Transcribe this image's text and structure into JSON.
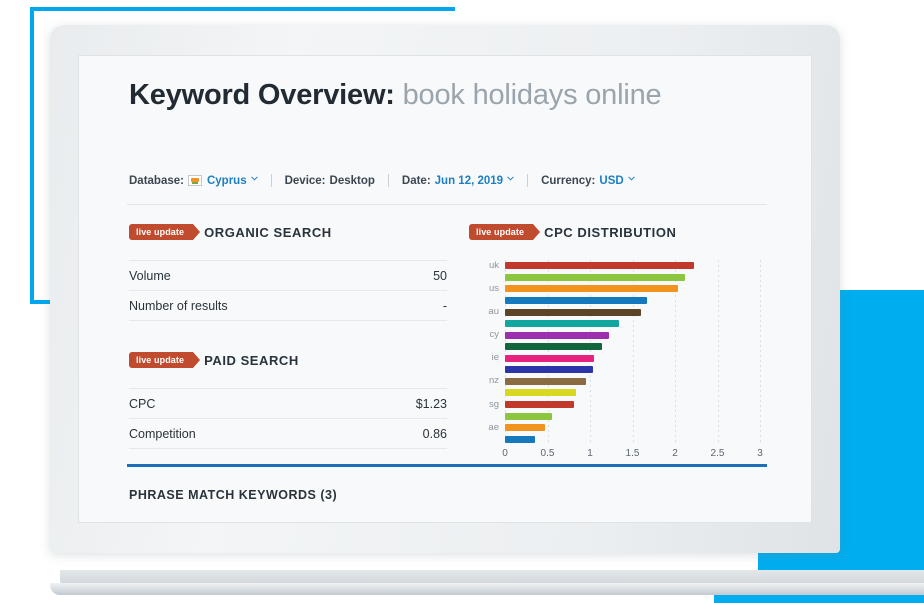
{
  "header": {
    "title_prefix": "Keyword Overview:",
    "keyword": "book holidays online"
  },
  "metabar": {
    "database_label": "Database:",
    "database_value": "Cyprus",
    "device_label": "Device:",
    "device_value": "Desktop",
    "date_label": "Date:",
    "date_value": "Jun 12, 2019",
    "currency_label": "Currency:",
    "currency_value": "USD"
  },
  "organic": {
    "badge": "live update",
    "title": "ORGANIC SEARCH",
    "rows": [
      {
        "label": "Volume",
        "value": "50"
      },
      {
        "label": "Number of results",
        "value": "-"
      }
    ]
  },
  "paid": {
    "badge": "live update",
    "title": "PAID SEARCH",
    "rows": [
      {
        "label": "CPC",
        "value": "$1.23"
      },
      {
        "label": "Competition",
        "value": "0.86"
      }
    ]
  },
  "cpc_section": {
    "badge": "live update",
    "title": "CPC DISTRIBUTION"
  },
  "bottom": {
    "phrase_match_title": "PHRASE MATCH KEYWORDS (3)"
  },
  "colors": {
    "accent_blue": "#00ADEF",
    "badge_red": "#c04b2e",
    "rule_blue": "#1c6fba",
    "link_blue": "#1c7fc4"
  },
  "chart_data": {
    "type": "bar",
    "orientation": "horizontal",
    "title": "CPC DISTRIBUTION",
    "xlabel": "",
    "ylabel": "",
    "xlim": [
      0,
      3
    ],
    "xticks": [
      0,
      0.5,
      1,
      1.5,
      2,
      2.5,
      3
    ],
    "xtick_labels": [
      "0",
      "0.5",
      "1",
      "1.5",
      "2",
      "2.5",
      "3"
    ],
    "grid": true,
    "legend": false,
    "categories": [
      "uk",
      "",
      "us",
      "",
      "au",
      "",
      "cy",
      "",
      "ie",
      "",
      "nz",
      "",
      "sg",
      "",
      "ae"
    ],
    "visible_ytick_labels": [
      "uk",
      "us",
      "au",
      "cy",
      "ie",
      "nz",
      "sg",
      "ae"
    ],
    "values": [
      2.22,
      2.12,
      2.04,
      1.67,
      1.6,
      1.34,
      1.22,
      1.14,
      1.05,
      1.04,
      0.95,
      0.84,
      0.81,
      0.55,
      0.47,
      0.35
    ],
    "bars": [
      {
        "category": "uk",
        "value": 2.22,
        "color": "#c0392b"
      },
      {
        "category": "",
        "value": 2.12,
        "color": "#8cc63f"
      },
      {
        "category": "us",
        "value": 2.04,
        "color": "#f2931e"
      },
      {
        "category": "",
        "value": 1.67,
        "color": "#1479bd"
      },
      {
        "category": "au",
        "value": 1.6,
        "color": "#5c4426"
      },
      {
        "category": "",
        "value": 1.34,
        "color": "#12a6a1"
      },
      {
        "category": "cy",
        "value": 1.22,
        "color": "#9b2fae"
      },
      {
        "category": "",
        "value": 1.14,
        "color": "#13663b"
      },
      {
        "category": "ie",
        "value": 1.05,
        "color": "#e6217e"
      },
      {
        "category": "",
        "value": 1.04,
        "color": "#2b34a8"
      },
      {
        "category": "nz",
        "value": 0.95,
        "color": "#8a6a41"
      },
      {
        "category": "",
        "value": 0.84,
        "color": "#d8d822"
      },
      {
        "category": "sg",
        "value": 0.81,
        "color": "#c0392b"
      },
      {
        "category": "",
        "value": 0.55,
        "color": "#8cc63f"
      },
      {
        "category": "ae",
        "value": 0.47,
        "color": "#f2931e"
      },
      {
        "category": "",
        "value": 0.35,
        "color": "#1479bd"
      }
    ]
  }
}
